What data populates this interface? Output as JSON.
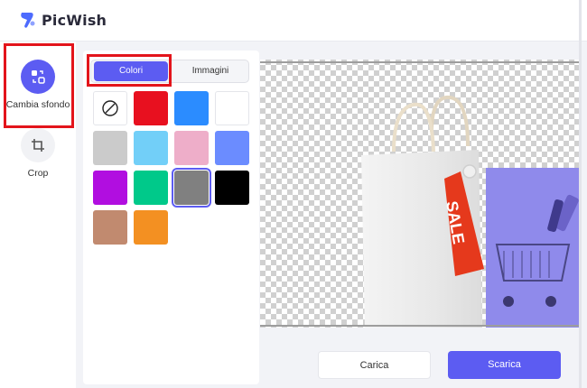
{
  "app": {
    "name": "PicWish",
    "brand_color": "#5c5cf2"
  },
  "toolbar": {
    "items": [
      {
        "label": "Cambia sfondo",
        "icon": "change-background-icon",
        "active": true
      },
      {
        "label": "Crop",
        "icon": "crop-icon",
        "active": false
      }
    ]
  },
  "panel": {
    "tabs": [
      {
        "label": "Colori",
        "active": true
      },
      {
        "label": "Immagini",
        "active": false
      }
    ],
    "no_color_icon": "no-color-icon",
    "swatches": [
      "#e8101f",
      "#2b8cff",
      "#ffffff",
      "#cbcbcb",
      "#72cff8",
      "#eeaec9",
      "#6b8cff",
      "#b10ee0",
      "#00c98a",
      "#808080",
      "#000000",
      "#c18a6f",
      "#f39022"
    ],
    "selected_swatch": "#808080"
  },
  "preview": {
    "tag_text": "SALE",
    "tag_color": "#e5391c"
  },
  "actions": {
    "upload_label": "Carica",
    "download_label": "Scarica"
  }
}
